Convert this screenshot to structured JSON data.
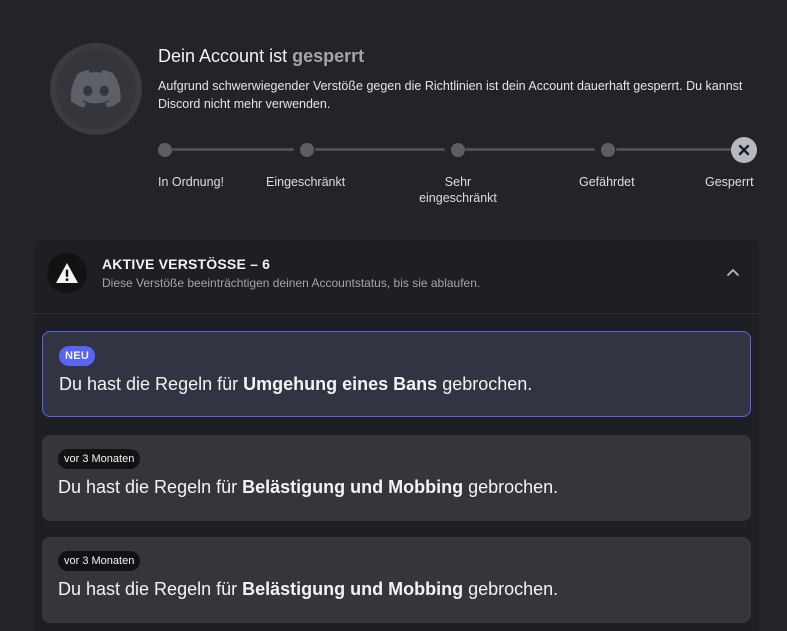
{
  "header": {
    "title_prefix": "Dein Account ist",
    "title_status": "gesperrt",
    "description": "Aufgrund schwerwiegender Verstöße gegen die Richtlinien ist dein Account dauerhaft gesperrt. Du kannst Discord nicht mehr verwenden."
  },
  "status_levels": [
    "In Ordnung!",
    "Eingeschränkt",
    "Sehr eingeschränkt",
    "Gefährdet",
    "Gesperrt"
  ],
  "violations": {
    "title": "AKTIVE VERSTÖSSE – 6",
    "subtitle": "Diese Verstöße beeinträchtigen deinen Accountstatus, bis sie ablaufen.",
    "items": [
      {
        "tag": "NEU",
        "prefix": "Du hast die Regeln für",
        "rule": "Umgehung eines Bans",
        "suffix": "gebrochen."
      },
      {
        "tag": "vor 3 Monaten",
        "prefix": "Du hast die Regeln für",
        "rule": "Belästigung und Mobbing",
        "suffix": "gebrochen."
      },
      {
        "tag": "vor 3 Monaten",
        "prefix": "Du hast die Regeln für",
        "rule": "Belästigung und Mobbing",
        "suffix": "gebrochen."
      }
    ]
  },
  "icons": {
    "avatar": "discord-logo-icon",
    "final_status": "close-icon",
    "warning": "warning-icon",
    "collapse": "chevron-up-icon"
  },
  "colors": {
    "accent": "#5865f2",
    "background": "#242428",
    "panel": "#1e1f22",
    "card": "#35363c"
  }
}
